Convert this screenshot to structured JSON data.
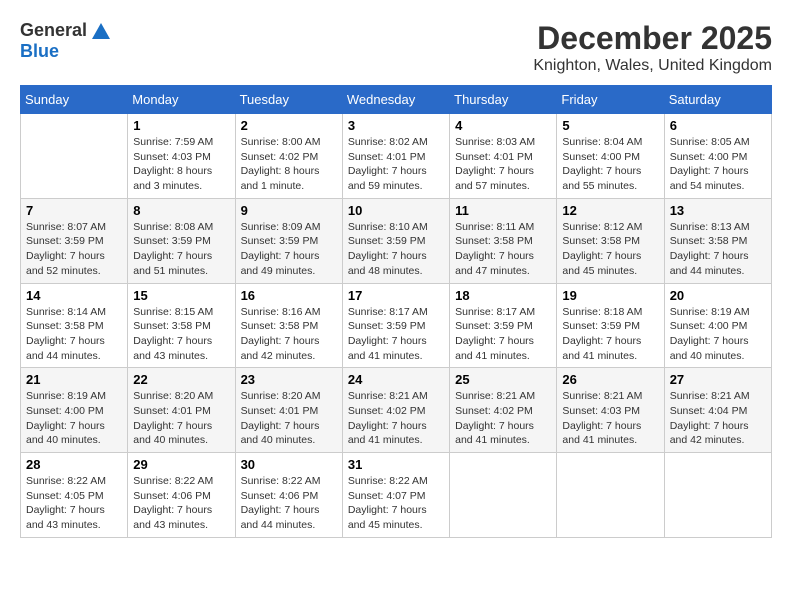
{
  "header": {
    "logo_general": "General",
    "logo_blue": "Blue",
    "title": "December 2025",
    "location": "Knighton, Wales, United Kingdom"
  },
  "days_of_week": [
    "Sunday",
    "Monday",
    "Tuesday",
    "Wednesday",
    "Thursday",
    "Friday",
    "Saturday"
  ],
  "weeks": [
    [
      {
        "day": "",
        "content": ""
      },
      {
        "day": "1",
        "content": "Sunrise: 7:59 AM\nSunset: 4:03 PM\nDaylight: 8 hours\nand 3 minutes."
      },
      {
        "day": "2",
        "content": "Sunrise: 8:00 AM\nSunset: 4:02 PM\nDaylight: 8 hours\nand 1 minute."
      },
      {
        "day": "3",
        "content": "Sunrise: 8:02 AM\nSunset: 4:01 PM\nDaylight: 7 hours\nand 59 minutes."
      },
      {
        "day": "4",
        "content": "Sunrise: 8:03 AM\nSunset: 4:01 PM\nDaylight: 7 hours\nand 57 minutes."
      },
      {
        "day": "5",
        "content": "Sunrise: 8:04 AM\nSunset: 4:00 PM\nDaylight: 7 hours\nand 55 minutes."
      },
      {
        "day": "6",
        "content": "Sunrise: 8:05 AM\nSunset: 4:00 PM\nDaylight: 7 hours\nand 54 minutes."
      }
    ],
    [
      {
        "day": "7",
        "content": "Sunrise: 8:07 AM\nSunset: 3:59 PM\nDaylight: 7 hours\nand 52 minutes."
      },
      {
        "day": "8",
        "content": "Sunrise: 8:08 AM\nSunset: 3:59 PM\nDaylight: 7 hours\nand 51 minutes."
      },
      {
        "day": "9",
        "content": "Sunrise: 8:09 AM\nSunset: 3:59 PM\nDaylight: 7 hours\nand 49 minutes."
      },
      {
        "day": "10",
        "content": "Sunrise: 8:10 AM\nSunset: 3:59 PM\nDaylight: 7 hours\nand 48 minutes."
      },
      {
        "day": "11",
        "content": "Sunrise: 8:11 AM\nSunset: 3:58 PM\nDaylight: 7 hours\nand 47 minutes."
      },
      {
        "day": "12",
        "content": "Sunrise: 8:12 AM\nSunset: 3:58 PM\nDaylight: 7 hours\nand 45 minutes."
      },
      {
        "day": "13",
        "content": "Sunrise: 8:13 AM\nSunset: 3:58 PM\nDaylight: 7 hours\nand 44 minutes."
      }
    ],
    [
      {
        "day": "14",
        "content": "Sunrise: 8:14 AM\nSunset: 3:58 PM\nDaylight: 7 hours\nand 44 minutes."
      },
      {
        "day": "15",
        "content": "Sunrise: 8:15 AM\nSunset: 3:58 PM\nDaylight: 7 hours\nand 43 minutes."
      },
      {
        "day": "16",
        "content": "Sunrise: 8:16 AM\nSunset: 3:58 PM\nDaylight: 7 hours\nand 42 minutes."
      },
      {
        "day": "17",
        "content": "Sunrise: 8:17 AM\nSunset: 3:59 PM\nDaylight: 7 hours\nand 41 minutes."
      },
      {
        "day": "18",
        "content": "Sunrise: 8:17 AM\nSunset: 3:59 PM\nDaylight: 7 hours\nand 41 minutes."
      },
      {
        "day": "19",
        "content": "Sunrise: 8:18 AM\nSunset: 3:59 PM\nDaylight: 7 hours\nand 41 minutes."
      },
      {
        "day": "20",
        "content": "Sunrise: 8:19 AM\nSunset: 4:00 PM\nDaylight: 7 hours\nand 40 minutes."
      }
    ],
    [
      {
        "day": "21",
        "content": "Sunrise: 8:19 AM\nSunset: 4:00 PM\nDaylight: 7 hours\nand 40 minutes."
      },
      {
        "day": "22",
        "content": "Sunrise: 8:20 AM\nSunset: 4:01 PM\nDaylight: 7 hours\nand 40 minutes."
      },
      {
        "day": "23",
        "content": "Sunrise: 8:20 AM\nSunset: 4:01 PM\nDaylight: 7 hours\nand 40 minutes."
      },
      {
        "day": "24",
        "content": "Sunrise: 8:21 AM\nSunset: 4:02 PM\nDaylight: 7 hours\nand 41 minutes."
      },
      {
        "day": "25",
        "content": "Sunrise: 8:21 AM\nSunset: 4:02 PM\nDaylight: 7 hours\nand 41 minutes."
      },
      {
        "day": "26",
        "content": "Sunrise: 8:21 AM\nSunset: 4:03 PM\nDaylight: 7 hours\nand 41 minutes."
      },
      {
        "day": "27",
        "content": "Sunrise: 8:21 AM\nSunset: 4:04 PM\nDaylight: 7 hours\nand 42 minutes."
      }
    ],
    [
      {
        "day": "28",
        "content": "Sunrise: 8:22 AM\nSunset: 4:05 PM\nDaylight: 7 hours\nand 43 minutes."
      },
      {
        "day": "29",
        "content": "Sunrise: 8:22 AM\nSunset: 4:06 PM\nDaylight: 7 hours\nand 43 minutes."
      },
      {
        "day": "30",
        "content": "Sunrise: 8:22 AM\nSunset: 4:06 PM\nDaylight: 7 hours\nand 44 minutes."
      },
      {
        "day": "31",
        "content": "Sunrise: 8:22 AM\nSunset: 4:07 PM\nDaylight: 7 hours\nand 45 minutes."
      },
      {
        "day": "",
        "content": ""
      },
      {
        "day": "",
        "content": ""
      },
      {
        "day": "",
        "content": ""
      }
    ]
  ]
}
